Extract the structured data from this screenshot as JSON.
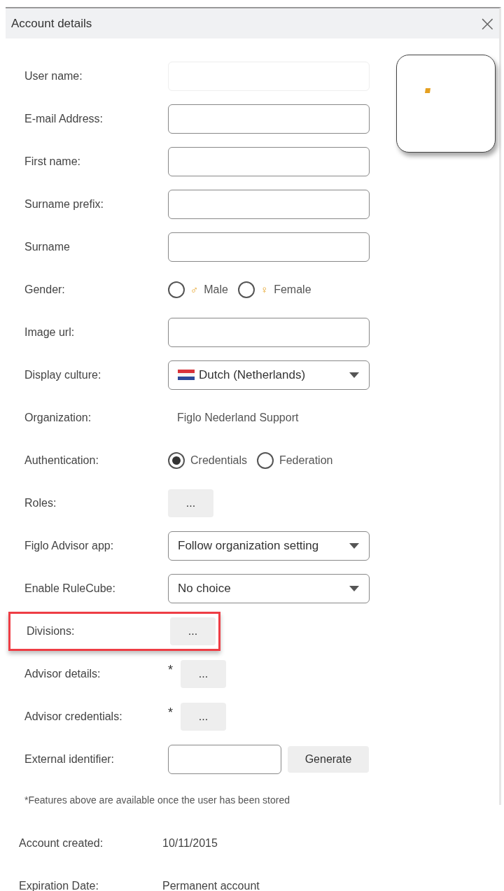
{
  "dialog": {
    "title": "Account details",
    "close": "×"
  },
  "rows": [
    {
      "kind": "input",
      "label": "User name:",
      "disabled": true
    },
    {
      "kind": "input",
      "label": "E-mail Address:",
      "disabled": false
    },
    {
      "kind": "input",
      "label": "First name:",
      "disabled": false
    },
    {
      "kind": "input",
      "label": "Surname prefix:",
      "disabled": false
    },
    {
      "kind": "input",
      "label": "Surname",
      "disabled": false
    },
    {
      "kind": "radio",
      "label": "Gender:",
      "options": [
        {
          "symbol": "♂",
          "label": "Male",
          "selected": false
        },
        {
          "symbol": "♀",
          "label": "Female",
          "selected": false
        }
      ]
    },
    {
      "kind": "input",
      "label": "Image url:",
      "disabled": false
    },
    {
      "kind": "select",
      "label": "Display culture:",
      "value": "Dutch (Netherlands)",
      "flag": true
    },
    {
      "kind": "text",
      "label": "Organization:",
      "value": "Figlo Nederland Support"
    },
    {
      "kind": "radio",
      "label": "Authentication:",
      "options": [
        {
          "label": "Credentials",
          "selected": true
        },
        {
          "label": "Federation",
          "selected": false
        }
      ]
    },
    {
      "kind": "more",
      "label": "Roles:",
      "button": "...",
      "highlighted": false
    },
    {
      "kind": "select",
      "label": "Figlo Advisor app:",
      "value": "Follow organization setting"
    },
    {
      "kind": "select",
      "label": "Enable RuleCube:",
      "value": "No choice"
    },
    {
      "kind": "more",
      "label": "Divisions:",
      "button": "...",
      "highlighted": true
    },
    {
      "kind": "more",
      "label": "Advisor details:",
      "asterisk": "*",
      "button": "...",
      "highlighted": false
    },
    {
      "kind": "more",
      "label": "Advisor credentials:",
      "asterisk": "*",
      "button": "...",
      "highlighted": false
    },
    {
      "kind": "input_button",
      "label": "External identifier:",
      "button": "Generate"
    }
  ],
  "note": "*Features above are available once the user has been stored",
  "info": [
    {
      "label": "Account created:",
      "value": "10/11/2015"
    },
    {
      "label": "Expiration Date:",
      "value": "Permanent account"
    }
  ]
}
